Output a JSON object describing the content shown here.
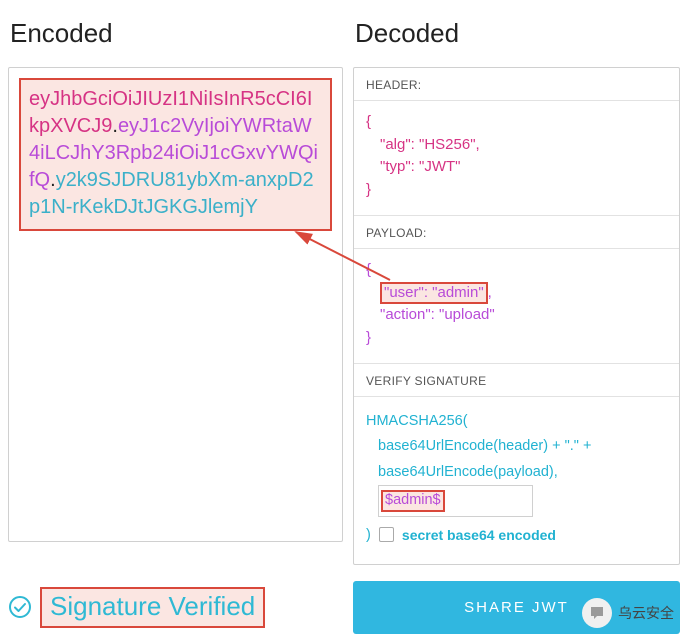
{
  "titles": {
    "encoded": "Encoded",
    "decoded": "Decoded"
  },
  "token": {
    "header": "eyJhbGciOiJIUzI1NiIsInR5cCI6IkpXVCJ9",
    "payload": "eyJ1c2VyIjoiYWRtaW4iLCJhY3Rpb24iOiJ1cGxvYWQifQ",
    "signature": "y2k9SJDRU81ybXm-anxpD2p1N-rKekDJtJGKGJlemjY"
  },
  "sections": {
    "header_label": "HEADER:",
    "payload_label": "PAYLOAD:",
    "verify_label": "VERIFY SIGNATURE"
  },
  "decoded_header": {
    "line1": "\"alg\": \"HS256\",",
    "line2": "\"typ\": \"JWT\""
  },
  "decoded_payload": {
    "line1": "\"user\": \"admin\"",
    "line1_suffix": ",",
    "line2": "\"action\": \"upload\""
  },
  "signature_block": {
    "fn": "HMACSHA256(",
    "l1": "base64UrlEncode(header) + \".\" +",
    "l2": "base64UrlEncode(payload),",
    "secret_value": "$admin$",
    "close": ")",
    "checkbox_label": "secret base64 encoded"
  },
  "status": {
    "verified": "Signature Verified"
  },
  "share": {
    "label": "SHARE JWT"
  },
  "watermark": {
    "text": "乌云安全"
  }
}
